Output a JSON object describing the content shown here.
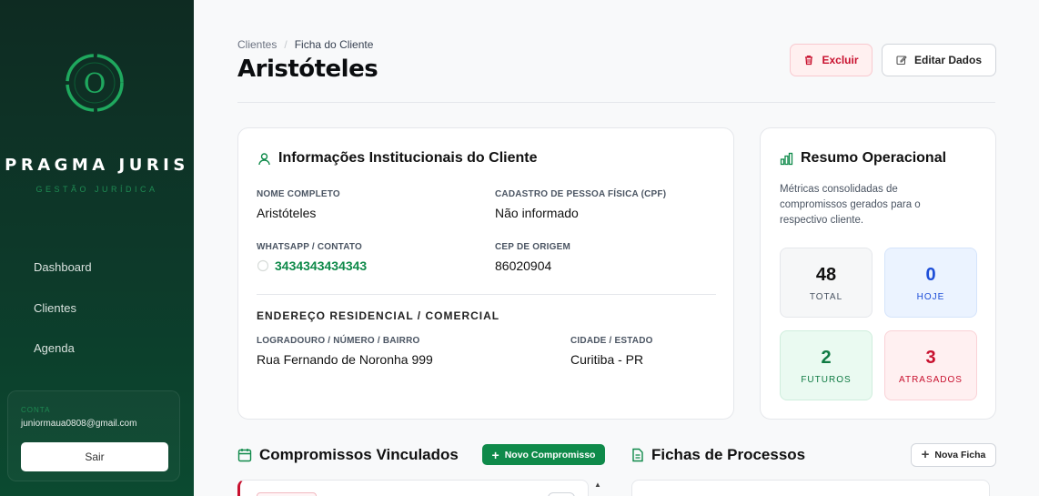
{
  "sidebar": {
    "brand_name": "PRAGMA JURIS",
    "brand_subtitle": "GESTÃO JURÍDICA",
    "logo_icon": "circle-o-logo",
    "nav": [
      {
        "label": "Dashboard"
      },
      {
        "label": "Clientes"
      },
      {
        "label": "Agenda"
      }
    ],
    "account": {
      "label": "CONTA",
      "email": "juniormaua0808@gmail.com",
      "logout_label": "Sair"
    }
  },
  "header": {
    "breadcrumb": [
      "Clientes",
      "Ficha do Cliente"
    ],
    "title": "Aristóteles",
    "delete_label": "Excluir",
    "edit_label": "Editar Dados"
  },
  "info_card": {
    "title": "Informações Institucionais do Cliente",
    "full_name_label": "NOME COMPLETO",
    "full_name": "Aristóteles",
    "cpf_label": "CADASTRO DE PESSOA FÍSICA (CPF)",
    "cpf": "Não informado",
    "whatsapp_label": "WHATSAPP / CONTATO",
    "whatsapp": "3434343434343",
    "cep_label": "CEP DE ORIGEM",
    "cep": "86020904",
    "address_heading": "ENDEREÇO RESIDENCIAL / COMERCIAL",
    "street_label": "LOGRADOURO / NÚMERO / BAIRRO",
    "street": "Rua Fernando de Noronha 999",
    "city_label": "CIDADE / ESTADO",
    "city": "Curitiba - PR"
  },
  "summary": {
    "title": "Resumo Operacional",
    "description": "Métricas consolidadas de compromissos gerados para o respectivo cliente.",
    "metrics": [
      {
        "value": "48",
        "label": "TOTAL"
      },
      {
        "value": "0",
        "label": "HOJE"
      },
      {
        "value": "2",
        "label": "FUTUROS"
      },
      {
        "value": "3",
        "label": "ATRASADOS"
      }
    ]
  },
  "appointments": {
    "title": "Compromissos Vinculados",
    "new_label": "Novo Compromisso"
  },
  "files": {
    "title": "Fichas de Processos",
    "new_label": "Nova Ficha"
  },
  "colors": {
    "accent_green": "#0f8a4a",
    "danger_red": "#c8102e",
    "info_blue": "#1d4ed8",
    "sidebar_dark": "#0e2b22"
  }
}
